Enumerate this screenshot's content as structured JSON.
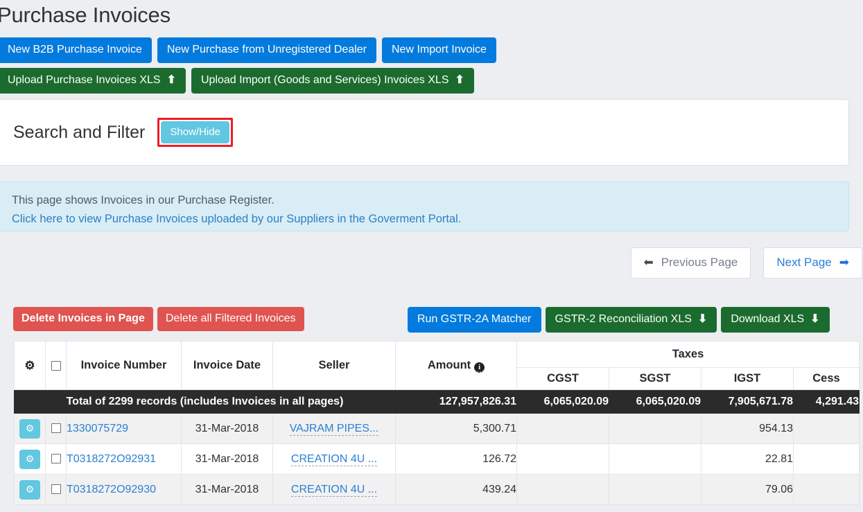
{
  "page_title": "Purchase Invoices",
  "top_actions": {
    "primary_buttons": [
      {
        "label": "New B2B Purchase Invoice"
      },
      {
        "label": "New Purchase from Unregistered Dealer"
      },
      {
        "label": "New Import Invoice"
      }
    ],
    "upload_buttons": [
      {
        "label": "Upload Purchase Invoices XLS",
        "icon": "arrow-up-icon",
        "glyph": "⬆"
      },
      {
        "label": "Upload Import (Goods and Services) Invoices XLS",
        "icon": "arrow-up-icon",
        "glyph": "⬆"
      }
    ]
  },
  "search_filter": {
    "title": "Search and Filter",
    "toggle_label": "Show/Hide",
    "highlight_color": "#ee1c25",
    "toggle_color": "#62c7e0"
  },
  "info_banner": {
    "line1": "This page shows Invoices in our Purchase Register.",
    "line2": "Click here to view Purchase Invoices uploaded by our Suppliers in the Goverment Portal.",
    "background": "#d9edf7",
    "link_color": "#2d7fc1"
  },
  "pagination": {
    "previous": {
      "label": "Previous Page",
      "icon": "arrow-left-icon",
      "glyph": "⬅"
    },
    "next": {
      "label": "Next Page",
      "icon": "arrow-right-icon",
      "glyph": "➡"
    }
  },
  "toolbar": {
    "delete_page": "Delete Invoices in Page",
    "delete_filtered": "Delete all Filtered Invoices",
    "run_matcher": "Run GSTR-2A Matcher",
    "reconciliation_xls": "GSTR-2 Reconciliation XLS",
    "download_xls": "Download XLS",
    "download_glyph": "⬇",
    "colors": {
      "danger": "#df5450",
      "primary": "#027ade",
      "success": "#1b6b2e"
    }
  },
  "table": {
    "group_header": "Taxes",
    "headers": {
      "gear": "⚙",
      "invoice_number": "Invoice Number",
      "invoice_date": "Invoice Date",
      "seller": "Seller",
      "amount": "Amount",
      "amount_info": "i",
      "cgst": "CGST",
      "sgst": "SGST",
      "igst": "IGST",
      "cess": "Cess"
    },
    "total_row": {
      "label": "Total of 2299 records (includes Invoices in all pages)",
      "amount": "127,957,826.31",
      "cgst": "6,065,020.09",
      "sgst": "6,065,020.09",
      "igst": "7,905,671.78",
      "cess": "4,291.43"
    },
    "rows": [
      {
        "gear": "⚙",
        "invoice_number": "1330075729",
        "invoice_date": "31-Mar-2018",
        "seller": "VAJRAM PIPES...",
        "amount": "5,300.71",
        "cgst": "",
        "sgst": "",
        "igst": "954.13",
        "cess": ""
      },
      {
        "gear": "⚙",
        "invoice_number": "T0318272O92931",
        "invoice_date": "31-Mar-2018",
        "seller": "CREATION 4U ...",
        "amount": "126.72",
        "cgst": "",
        "sgst": "",
        "igst": "22.81",
        "cess": ""
      },
      {
        "gear": "⚙",
        "invoice_number": "T0318272O92930",
        "invoice_date": "31-Mar-2018",
        "seller": "CREATION 4U ...",
        "amount": "439.24",
        "cgst": "",
        "sgst": "",
        "igst": "79.06",
        "cess": ""
      }
    ]
  }
}
